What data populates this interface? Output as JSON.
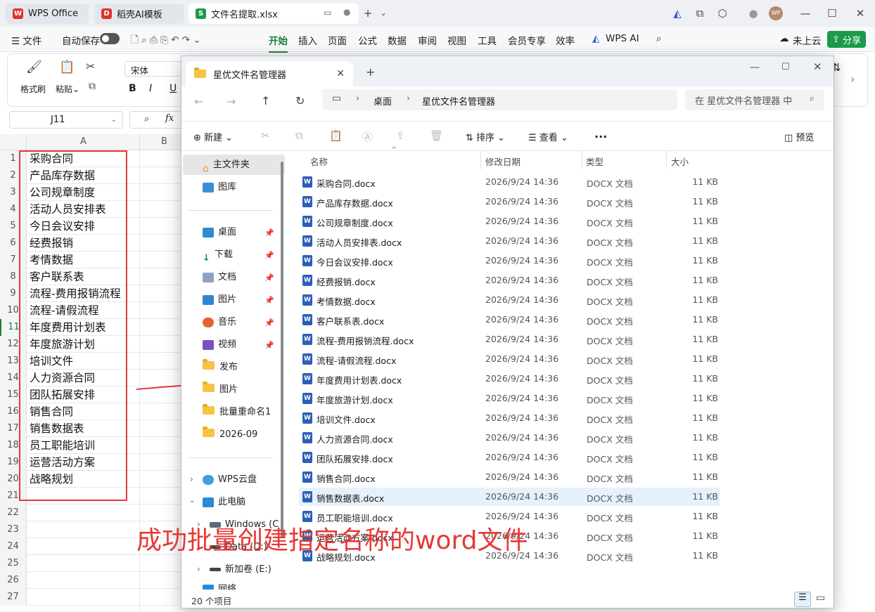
{
  "tabs": [
    {
      "label": "WPS Office",
      "icon": "wps-logo-icon"
    },
    {
      "label": "稻壳AI模板",
      "icon": "docer-icon"
    },
    {
      "label": "文件名提取.xlsx",
      "icon": "spreadsheet-icon"
    }
  ],
  "menu": {
    "file": "文件",
    "autosave": "自动保存",
    "items": [
      "开始",
      "插入",
      "页面",
      "公式",
      "数据",
      "审阅",
      "视图",
      "工具",
      "会员专享",
      "效率"
    ],
    "wps_ai": "WPS AI",
    "cloud": "未上云",
    "share": "分享"
  },
  "ribbon": {
    "format_painter": "格式刷",
    "paste": "粘贴",
    "font": "宋体",
    "bold": "B",
    "italic": "I",
    "underline": "U"
  },
  "formula_bar": {
    "cell_ref": "J11",
    "fx": "fx"
  },
  "sheet": {
    "columns": [
      "A",
      "B"
    ],
    "row_numbers": [
      "1",
      "2",
      "3",
      "4",
      "5",
      "6",
      "7",
      "8",
      "9",
      "10",
      "11",
      "12",
      "13",
      "14",
      "15",
      "16",
      "17",
      "18",
      "19",
      "20",
      "21",
      "22",
      "23",
      "24",
      "25",
      "26",
      "27"
    ],
    "cells": [
      "采购合同",
      "产品库存数据",
      "公司规章制度",
      "活动人员安排表",
      "今日会议安排",
      "经费报销",
      "考情数据",
      "客户联系表",
      "流程-费用报销流程",
      "流程-请假流程",
      "年度费用计划表",
      "年度旅游计划",
      "培训文件",
      "人力资源合同",
      "团队拓展安排",
      "销售合同",
      "销售数据表",
      "员工职能培训",
      "运营活动方案",
      "战略规划"
    ]
  },
  "explorer": {
    "tab_title": "星优文件名管理器",
    "breadcrumb": [
      "桌面",
      "星优文件名管理器"
    ],
    "search_placeholder": "在 星优文件名管理器 中",
    "commands": {
      "new": "新建",
      "sort": "排序",
      "view": "查看",
      "more": "...",
      "preview": "预览"
    },
    "nav": {
      "home": "主文件夹",
      "gallery": "图库",
      "desktop": "桌面",
      "downloads": "下载",
      "documents": "文档",
      "pictures": "图片",
      "music": "音乐",
      "videos": "视频",
      "publish": "发布",
      "pictures2": "图片",
      "batch": "批量重命名1",
      "month": "2026-09",
      "wps_cloud": "WPS云盘",
      "this_pc": "此电脑",
      "windows": "Windows (C",
      "data": "Data (D:)",
      "new_vol": "新加卷 (E:)",
      "network": "网络"
    },
    "headers": {
      "name": "名称",
      "date": "修改日期",
      "type": "类型",
      "size": "大小"
    },
    "files": [
      {
        "name": "采购合同.docx"
      },
      {
        "name": "产品库存数据.docx"
      },
      {
        "name": "公司规章制度.docx"
      },
      {
        "name": "活动人员安排表.docx"
      },
      {
        "name": "今日会议安排.docx"
      },
      {
        "name": "经费报销.docx"
      },
      {
        "name": "考情数据.docx"
      },
      {
        "name": "客户联系表.docx"
      },
      {
        "name": "流程-费用报销流程.docx"
      },
      {
        "name": "流程-请假流程.docx"
      },
      {
        "name": "年度费用计划表.docx"
      },
      {
        "name": "年度旅游计划.docx"
      },
      {
        "name": "培训文件.docx"
      },
      {
        "name": "人力资源合同.docx"
      },
      {
        "name": "团队拓展安排.docx"
      },
      {
        "name": "销售合同.docx"
      },
      {
        "name": "销售数据表.docx"
      },
      {
        "name": "员工职能培训.docx"
      },
      {
        "name": "运营活动方案.docx"
      },
      {
        "name": "战略规划.docx"
      }
    ],
    "file_date": "2026/9/24 14:36",
    "file_type": "DOCX 文档",
    "file_size": "11 KB",
    "selected_file": "销售数据表.docx",
    "status": "20 个项目"
  },
  "annotation": {
    "caption": "成功批量创建指定名称的word文件",
    "color": "#e53935"
  },
  "colors": {
    "accent_green": "#1a7f3c",
    "share_green": "#1a9a4a",
    "word_blue": "#2b5fb8"
  }
}
